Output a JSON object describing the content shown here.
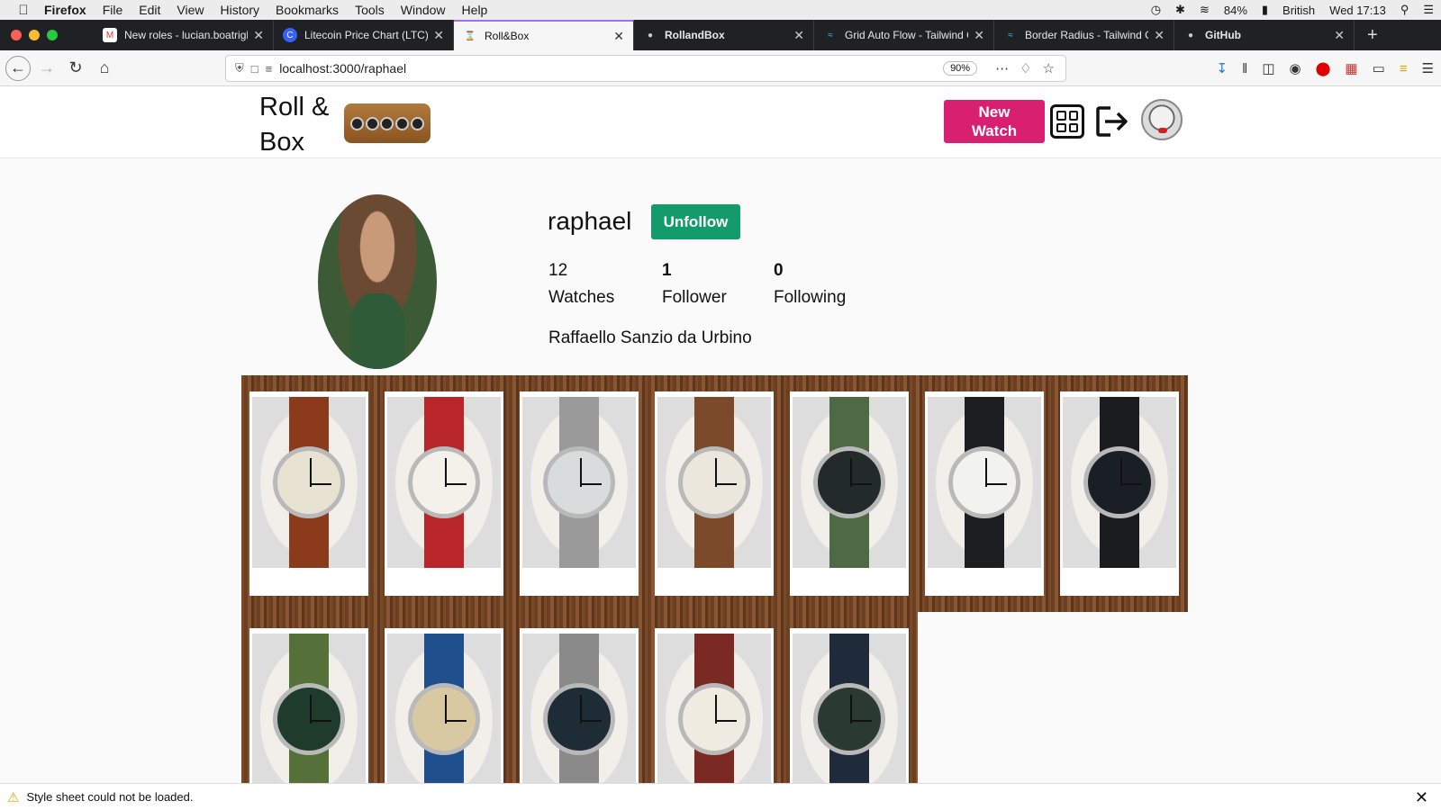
{
  "menubar": {
    "items": [
      "Firefox",
      "File",
      "Edit",
      "View",
      "History",
      "Bookmarks",
      "Tools",
      "Window",
      "Help"
    ],
    "battery": "84%",
    "input_source": "British",
    "clock": "Wed 17:13"
  },
  "tabs": [
    {
      "title": "New roles - lucian.boatrigh",
      "icon": "gmail-icon"
    },
    {
      "title": "Litecoin Price Chart (LTC) |",
      "icon": "coinmarket-icon"
    },
    {
      "title": "Roll&Box",
      "icon": "watch-icon",
      "active": true
    },
    {
      "title": "RollandBox",
      "icon": "github-icon"
    },
    {
      "title": "Grid Auto Flow - Tailwind C",
      "icon": "tailwind-icon"
    },
    {
      "title": "Border Radius - Tailwind CS",
      "icon": "tailwind-icon"
    },
    {
      "title": "GitHub",
      "icon": "github-icon"
    }
  ],
  "navbar": {
    "url": "localhost:3000/raphael",
    "zoom": "90%"
  },
  "site": {
    "logo_line1": "Roll &",
    "logo_line2": "Box",
    "new_watch_line1": "New",
    "new_watch_line2": "Watch"
  },
  "profile": {
    "username": "raphael",
    "unfollow_label": "Unfollow",
    "watches_count": "12",
    "watches_label": "Watches",
    "followers_count": "1",
    "followers_label": "Follower",
    "following_count": "0",
    "following_label": "Following",
    "full_name": "Raffaello Sanzio da Urbino"
  },
  "watches": [
    {
      "strap_color": "#8c3a1c",
      "dial_color": "#e8e2d2"
    },
    {
      "strap_color": "#b8262a",
      "dial_color": "#f4f1ea"
    },
    {
      "strap_color": "#9a9a9a",
      "dial_color": "#d9dcdc"
    },
    {
      "strap_color": "#7a4a2a",
      "dial_color": "#ece7dc"
    },
    {
      "strap_color": "#4d6a45",
      "dial_color": "#222a2a"
    },
    {
      "strap_color": "#1c1e22",
      "dial_color": "#f2f2ee"
    },
    {
      "strap_color": "#1a1c20",
      "dial_color": "#1a1f26"
    },
    {
      "strap_color": "#56703a",
      "dial_color": "#1f3b2c"
    },
    {
      "strap_color": "#1f4f8c",
      "dial_color": "#d8c9a2"
    },
    {
      "strap_color": "#8a8a8a",
      "dial_color": "#1d2c35"
    },
    {
      "strap_color": "#7a2a22",
      "dial_color": "#f0ebe0"
    },
    {
      "strap_color": "#1f2a3a",
      "dial_color": "#2a3a32"
    }
  ],
  "statusbar": {
    "message": "Style sheet could not be loaded."
  },
  "colors": {
    "new_watch_button": "#d91f6f",
    "unfollow_button": "#149b6b"
  }
}
